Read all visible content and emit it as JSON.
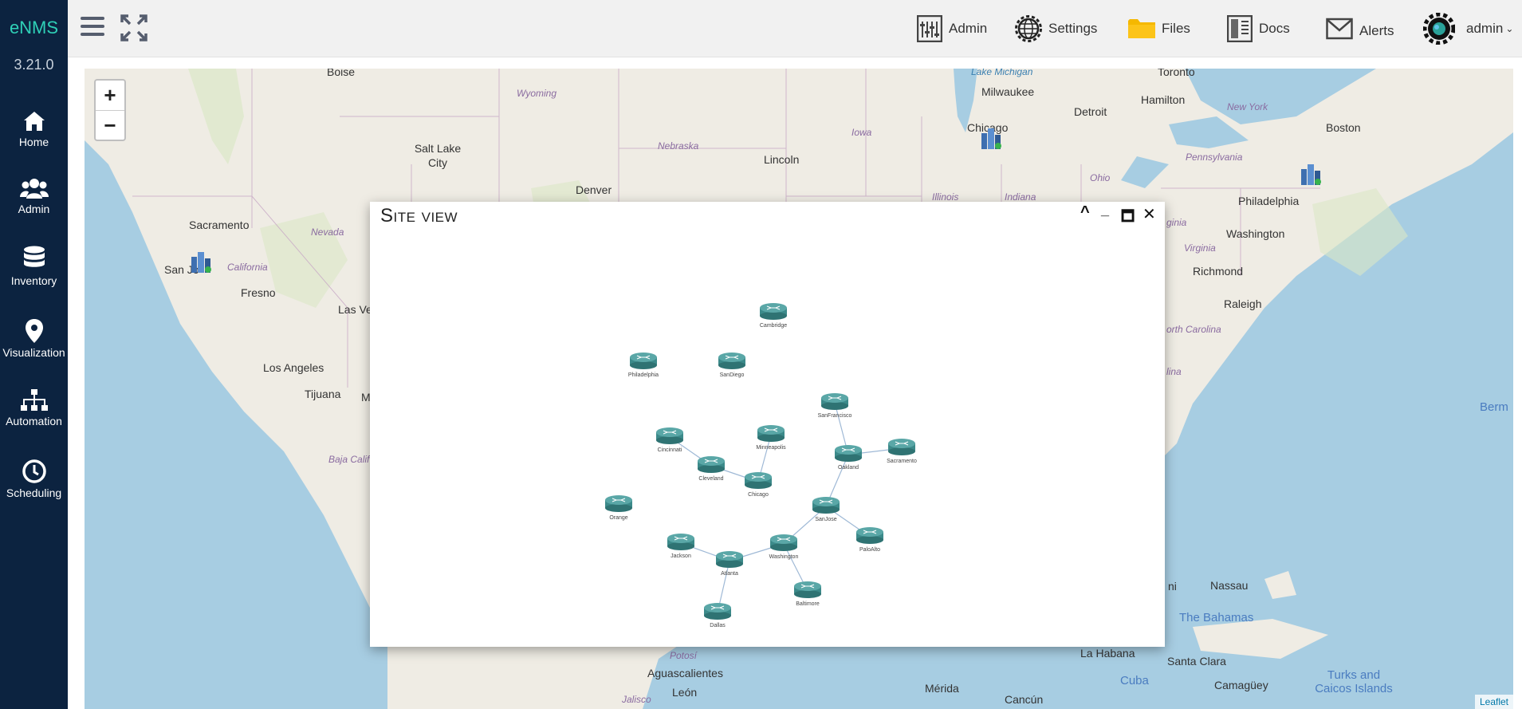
{
  "app": {
    "brand": "eNMS",
    "version": "3.21.0"
  },
  "sidebar": {
    "items": [
      {
        "label": "Home",
        "icon": "home-icon"
      },
      {
        "label": "Admin",
        "icon": "users-icon"
      },
      {
        "label": "Inventory",
        "icon": "database-icon"
      },
      {
        "label": "Visualization",
        "icon": "map-marker-icon"
      },
      {
        "label": "Automation",
        "icon": "sitemap-icon"
      },
      {
        "label": "Scheduling",
        "icon": "clock-icon"
      }
    ]
  },
  "topbar": {
    "items": [
      {
        "label": "Admin",
        "icon": "admin-panel-icon"
      },
      {
        "label": "Settings",
        "icon": "globe-gear-icon"
      },
      {
        "label": "Files",
        "icon": "folder-icon"
      },
      {
        "label": "Docs",
        "icon": "docs-icon"
      },
      {
        "label": "Alerts",
        "icon": "envelope-icon"
      }
    ],
    "user": "admin"
  },
  "map": {
    "zoom_in": "+",
    "zoom_out": "−",
    "attribution": "Leaflet",
    "labels": [
      {
        "text": "Boise",
        "kind": "city"
      },
      {
        "text": "Wyoming",
        "kind": "state"
      },
      {
        "text": "Lake Michigan",
        "kind": "sea"
      },
      {
        "text": "Toronto",
        "kind": "city"
      },
      {
        "text": "Milwaukee",
        "kind": "city"
      },
      {
        "text": "Hamilton",
        "kind": "city"
      },
      {
        "text": "New York",
        "kind": "state"
      },
      {
        "text": "Detroit",
        "kind": "city"
      },
      {
        "text": "Boston",
        "kind": "city"
      },
      {
        "text": "Salt Lake City",
        "kind": "city"
      },
      {
        "text": "Nebraska",
        "kind": "state"
      },
      {
        "text": "Iowa",
        "kind": "state"
      },
      {
        "text": "Chicago",
        "kind": "city"
      },
      {
        "text": "Lincoln",
        "kind": "city"
      },
      {
        "text": "Pennsylvania",
        "kind": "state"
      },
      {
        "text": "Denver",
        "kind": "city"
      },
      {
        "text": "Ohio",
        "kind": "state"
      },
      {
        "text": "Illinois",
        "kind": "state"
      },
      {
        "text": "Indiana",
        "kind": "state"
      },
      {
        "text": "Philadelphia",
        "kind": "city"
      },
      {
        "text": "Sacramento",
        "kind": "city"
      },
      {
        "text": "Nevada",
        "kind": "state"
      },
      {
        "text": "ginia",
        "kind": "state"
      },
      {
        "text": "Washington",
        "kind": "city"
      },
      {
        "text": "Virginia",
        "kind": "state"
      },
      {
        "text": "Richmond",
        "kind": "city"
      },
      {
        "text": "San Jo",
        "kind": "city"
      },
      {
        "text": "California",
        "kind": "state"
      },
      {
        "text": "Fresno",
        "kind": "city"
      },
      {
        "text": "Las Ve",
        "kind": "city"
      },
      {
        "text": "Raleigh",
        "kind": "city"
      },
      {
        "text": "orth Carolina",
        "kind": "state"
      },
      {
        "text": "Los Angeles",
        "kind": "city"
      },
      {
        "text": "Tijuana",
        "kind": "city"
      },
      {
        "text": "M",
        "kind": "city"
      },
      {
        "text": "lina",
        "kind": "state"
      },
      {
        "text": "Berm",
        "kind": "country"
      },
      {
        "text": "Baja Calif",
        "kind": "state"
      },
      {
        "text": "ni",
        "kind": "city"
      },
      {
        "text": "Nassau",
        "kind": "city"
      },
      {
        "text": "The Bahamas",
        "kind": "country"
      },
      {
        "text": "Potosí",
        "kind": "state"
      },
      {
        "text": "Aguascalientes",
        "kind": "city"
      },
      {
        "text": "La Habana",
        "kind": "city"
      },
      {
        "text": "Santa Clara",
        "kind": "city"
      },
      {
        "text": "Turks and Caicos Islands",
        "kind": "country"
      },
      {
        "text": "Cuba",
        "kind": "country"
      },
      {
        "text": "Camagüey",
        "kind": "city"
      },
      {
        "text": "Jalisco",
        "kind": "state"
      },
      {
        "text": "León",
        "kind": "city"
      },
      {
        "text": "Mérida",
        "kind": "city"
      },
      {
        "text": "Cancún",
        "kind": "city"
      }
    ]
  },
  "site_view": {
    "title": "Site view",
    "controls": {
      "collapse": "^",
      "minimize": "_",
      "maximize": "🗖",
      "close": "✕"
    },
    "nodes": [
      "Cambridge",
      "Philadelphia",
      "SanDiego",
      "SanFrancisco",
      "Cincinnati",
      "Minneapolis",
      "Sacramento",
      "Cleveland",
      "Oakland",
      "Chicago",
      "Orange",
      "SanJose",
      "PaloAlto",
      "Jackson",
      "Washington",
      "Atlanta",
      "Baltimore",
      "Dallas"
    ],
    "links": [
      [
        "SanFrancisco",
        "Oakland"
      ],
      [
        "Oakland",
        "Sacramento"
      ],
      [
        "Oakland",
        "SanJose"
      ],
      [
        "SanJose",
        "PaloAlto"
      ],
      [
        "SanJose",
        "Washington"
      ],
      [
        "Cincinnati",
        "Cleveland"
      ],
      [
        "Cleveland",
        "Chicago"
      ],
      [
        "Minneapolis",
        "Chicago"
      ],
      [
        "Jackson",
        "Atlanta"
      ],
      [
        "Atlanta",
        "Washington"
      ],
      [
        "Washington",
        "Baltimore"
      ],
      [
        "Atlanta",
        "Dallas"
      ]
    ]
  }
}
